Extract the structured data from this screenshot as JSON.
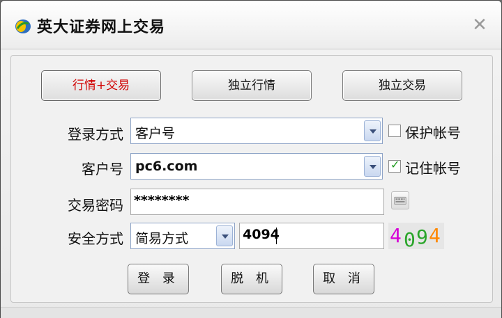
{
  "window": {
    "title": "英大证券网上交易",
    "close_symbol": "✕"
  },
  "modes": [
    {
      "label": "行情+交易",
      "active": true
    },
    {
      "label": "独立行情",
      "active": false
    },
    {
      "label": "独立交易",
      "active": false
    }
  ],
  "form": {
    "login_method": {
      "label": "登录方式",
      "value": "客户号"
    },
    "protect_account": {
      "label": "保护帐号",
      "checked": false
    },
    "account": {
      "label": "客户号",
      "value": "pc6.com"
    },
    "remember_account": {
      "label": "记住帐号",
      "checked": true
    },
    "password": {
      "label": "交易密码",
      "value": "********"
    },
    "security": {
      "label": "安全方式",
      "method": "简易方式",
      "code_input": "4094"
    },
    "captcha": {
      "chars": [
        "4",
        "0",
        "9",
        "4"
      ],
      "colors": [
        "#d600d6",
        "#2aa52a",
        "#2aa52a",
        "#ff8800"
      ]
    }
  },
  "actions": {
    "login": "登 录",
    "offline": "脱 机",
    "cancel": "取 消"
  }
}
